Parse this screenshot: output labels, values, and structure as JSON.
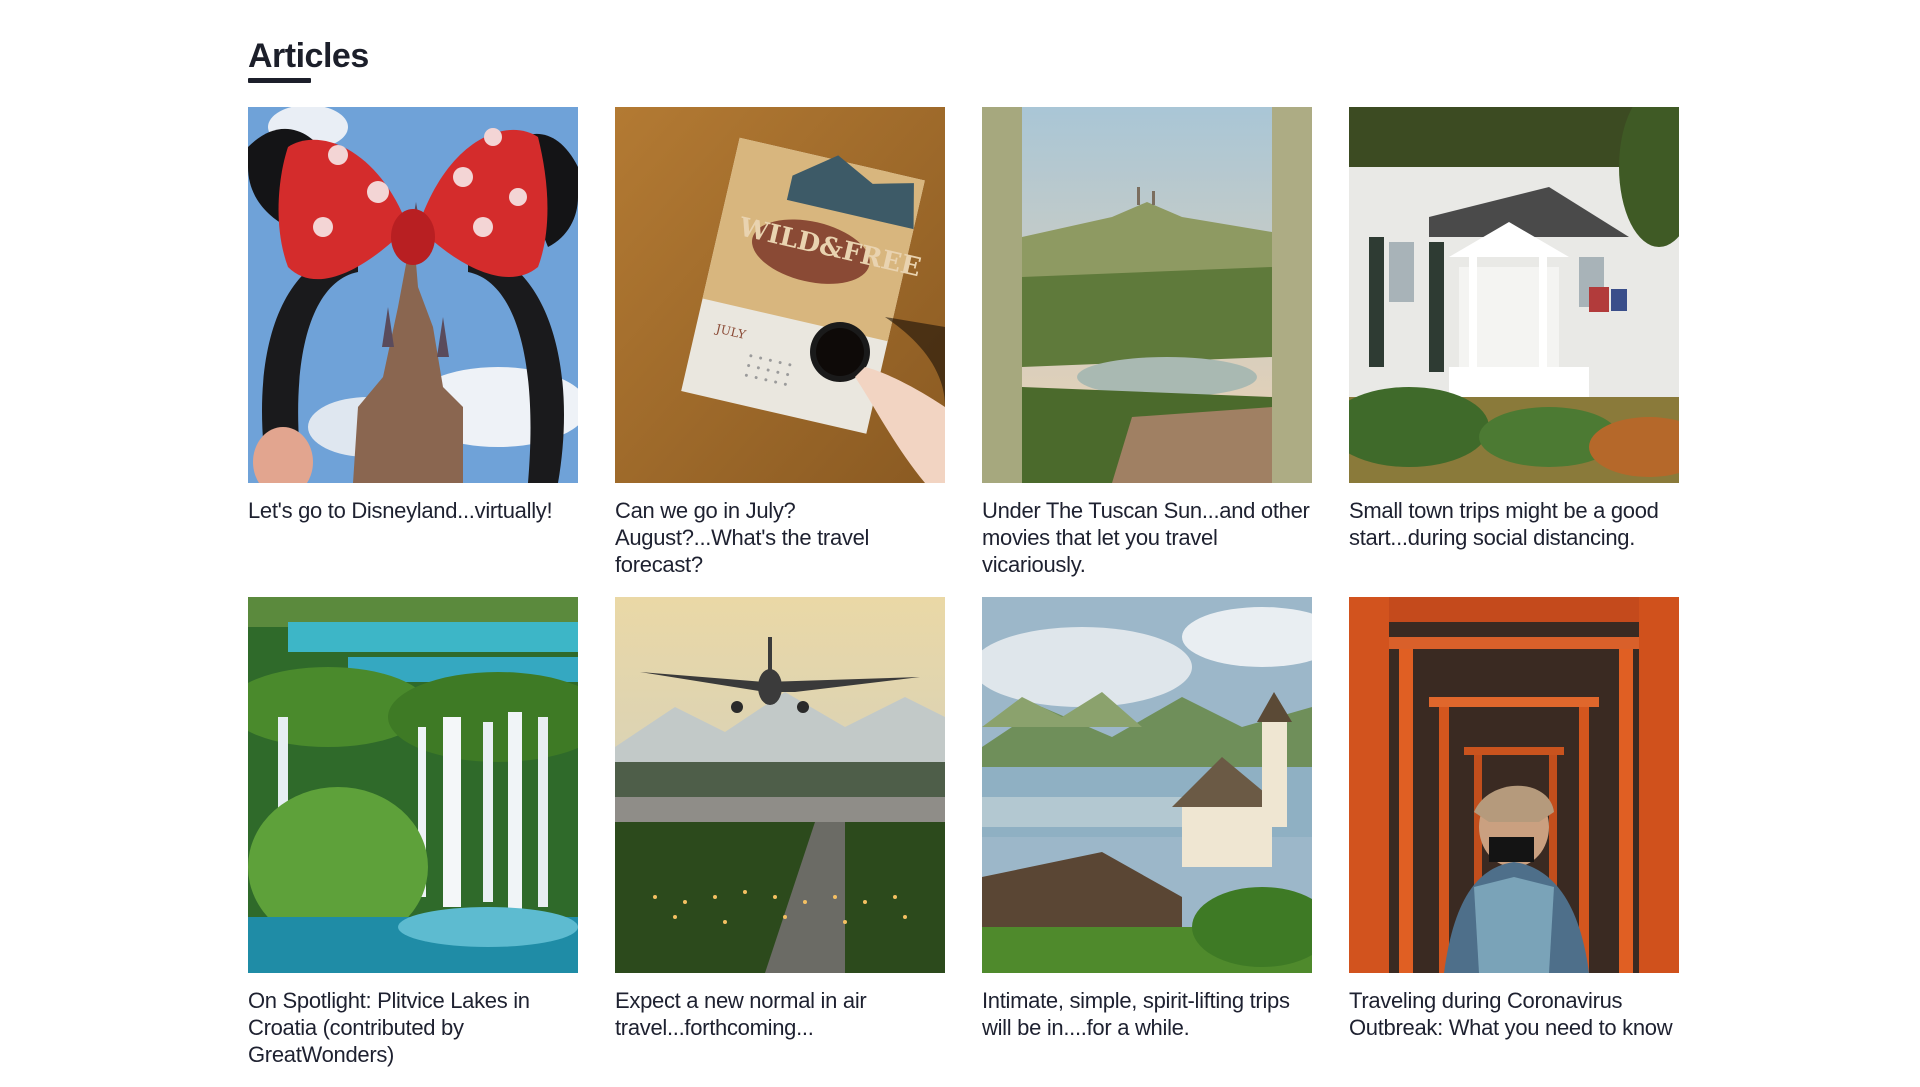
{
  "section": {
    "heading": "Articles"
  },
  "articles": [
    {
      "title": "Let's go to Disneyland...virtually!",
      "image": "disney-castle-minnie-ears"
    },
    {
      "title": "Can we go in July? August?...What's the travel forecast?",
      "image": "calendar-coffee-table"
    },
    {
      "title": "Under The Tuscan Sun...and other movies that let you travel vicariously.",
      "image": "tuscan-hills-lake"
    },
    {
      "title": "Small town trips might be a good start...during social distancing.",
      "image": "white-colonial-house"
    },
    {
      "title": "On Spotlight: Plitvice Lakes in Croatia (contributed by GreatWonders)",
      "image": "plitvice-waterfalls"
    },
    {
      "title": "Expect a new normal in air travel...forthcoming...",
      "image": "airplane-landing-runway"
    },
    {
      "title": "Intimate, simple, spirit-lifting trips will be in....for a while.",
      "image": "alpine-lake-village"
    },
    {
      "title": "Traveling during Coronavirus Outbreak: What you need to know",
      "image": "man-mask-torii-gates"
    }
  ],
  "colors": {
    "heading": "#1c1f2a",
    "title": "#1e2130",
    "background": "#ffffff"
  }
}
